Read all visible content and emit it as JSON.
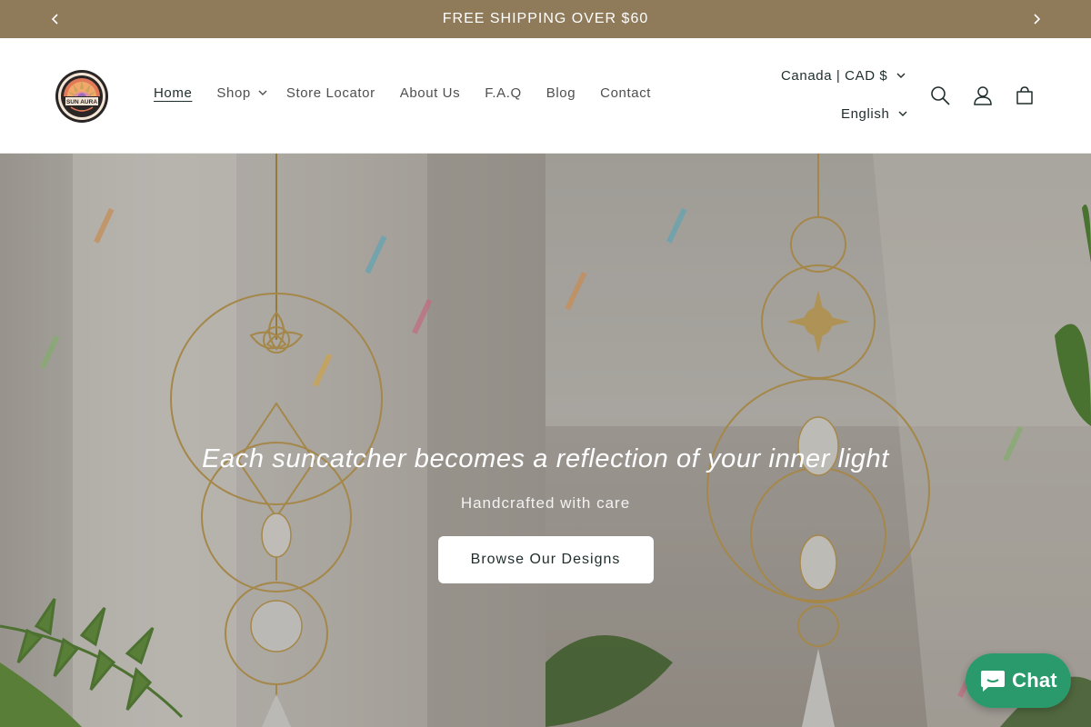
{
  "announcement": {
    "text": "FREE SHIPPING OVER $60",
    "prev_icon": "chevron-left-icon",
    "next_icon": "chevron-right-icon"
  },
  "header": {
    "logo_text": "SUN AURA",
    "nav": [
      {
        "label": "Home",
        "active": true
      },
      {
        "label": "Shop",
        "dropdown": true
      },
      {
        "label": "Store Locator"
      },
      {
        "label": "About Us"
      },
      {
        "label": "F.A.Q"
      },
      {
        "label": "Blog"
      },
      {
        "label": "Contact"
      }
    ],
    "country_selector": "Canada | CAD $",
    "language_selector": "English",
    "icons": [
      "search-icon",
      "account-icon",
      "cart-icon"
    ]
  },
  "hero": {
    "title": "Each suncatcher becomes a reflection of your inner light",
    "subtitle": "Handcrafted with care",
    "button_label": "Browse Our Designs"
  },
  "chat": {
    "label": "Chat",
    "color": "#2a9a6c"
  },
  "colors": {
    "announcement_bg": "#8f7a5a",
    "text_dark": "#1e2d2c",
    "hero_gold": "#c9a55a"
  }
}
